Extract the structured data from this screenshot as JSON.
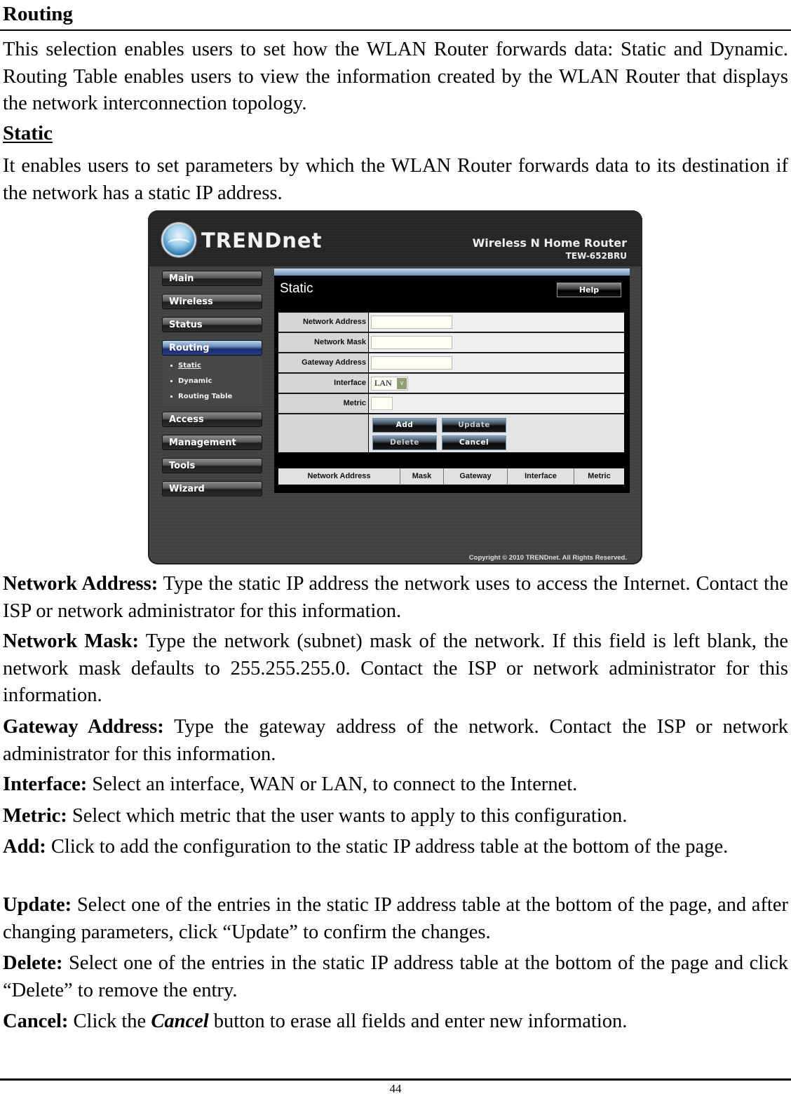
{
  "heading": "Routing",
  "intro": "This selection enables users to set how the WLAN Router forwards data: Static and Dynamic. Routing Table enables users to view the information created by the WLAN Router that displays the network interconnection topology.",
  "subheading": "Static",
  "subintro": "It enables users to set parameters by which the WLAN Router forwards data to its destination if the network has a static IP address.",
  "router_ui": {
    "brand": "TRENDnet",
    "product_name": "Wireless N Home Router",
    "product_model": "TEW-652BRU",
    "nav": [
      {
        "label": "Main"
      },
      {
        "label": "Wireless"
      },
      {
        "label": "Status"
      },
      {
        "label": "Routing",
        "active": true
      },
      {
        "label": "Access"
      },
      {
        "label": "Management"
      },
      {
        "label": "Tools"
      },
      {
        "label": "Wizard"
      }
    ],
    "subnav": [
      {
        "label": "Static",
        "current": true
      },
      {
        "label": "Dynamic"
      },
      {
        "label": "Routing Table"
      }
    ],
    "panel_title": "Static",
    "help_label": "Help",
    "fields": {
      "network_address": {
        "label": "Network Address",
        "value": ""
      },
      "network_mask": {
        "label": "Network Mask",
        "value": ""
      },
      "gateway_address": {
        "label": "Gateway Address",
        "value": ""
      },
      "interface": {
        "label": "Interface",
        "value": "LAN"
      },
      "metric": {
        "label": "Metric",
        "value": ""
      }
    },
    "buttons": {
      "add": "Add",
      "update": "Update",
      "delete": "Delete",
      "cancel": "Cancel"
    },
    "table_headers": [
      "Network Address",
      "Mask",
      "Gateway",
      "Interface",
      "Metric"
    ],
    "copyright": "Copyright © 2010 TRENDnet. All Rights Reserved."
  },
  "descriptions": [
    {
      "term": "Network Address:",
      "text": " Type the static IP address the network uses to access the Internet. Contact the ISP or network administrator for this information."
    },
    {
      "term": "Network Mask:",
      "text": " Type the network (subnet) mask of the network. If this field is left blank, the network mask defaults to 255.255.255.0.  Contact the ISP or network administrator for this information."
    },
    {
      "term": "Gateway Address:",
      "text": " Type the gateway address of the network. Contact the ISP or network administrator for this information."
    },
    {
      "term": "Interface:",
      "text": " Select an interface, WAN or LAN, to connect to the Internet."
    },
    {
      "term": "Metric:",
      "text": " Select which metric that the user wants to apply to this configuration."
    },
    {
      "term": "Add:",
      "text": " Click to add the configuration to the static IP address table at the bottom of the page."
    },
    {
      "term": "Update:",
      "text": " Select one of the entries in the static IP address table at the bottom of the page, and after changing parameters, click “Update” to confirm the changes."
    },
    {
      "term": "Delete:",
      "text": " Select one of the entries in the static IP address table at the bottom of the page and click “Delete” to remove the entry."
    },
    {
      "term": "Cancel:",
      "text_before": " Click the ",
      "emph": "Cancel",
      "text_after": " button to erase all fields and enter new information."
    }
  ],
  "page_number": "44"
}
